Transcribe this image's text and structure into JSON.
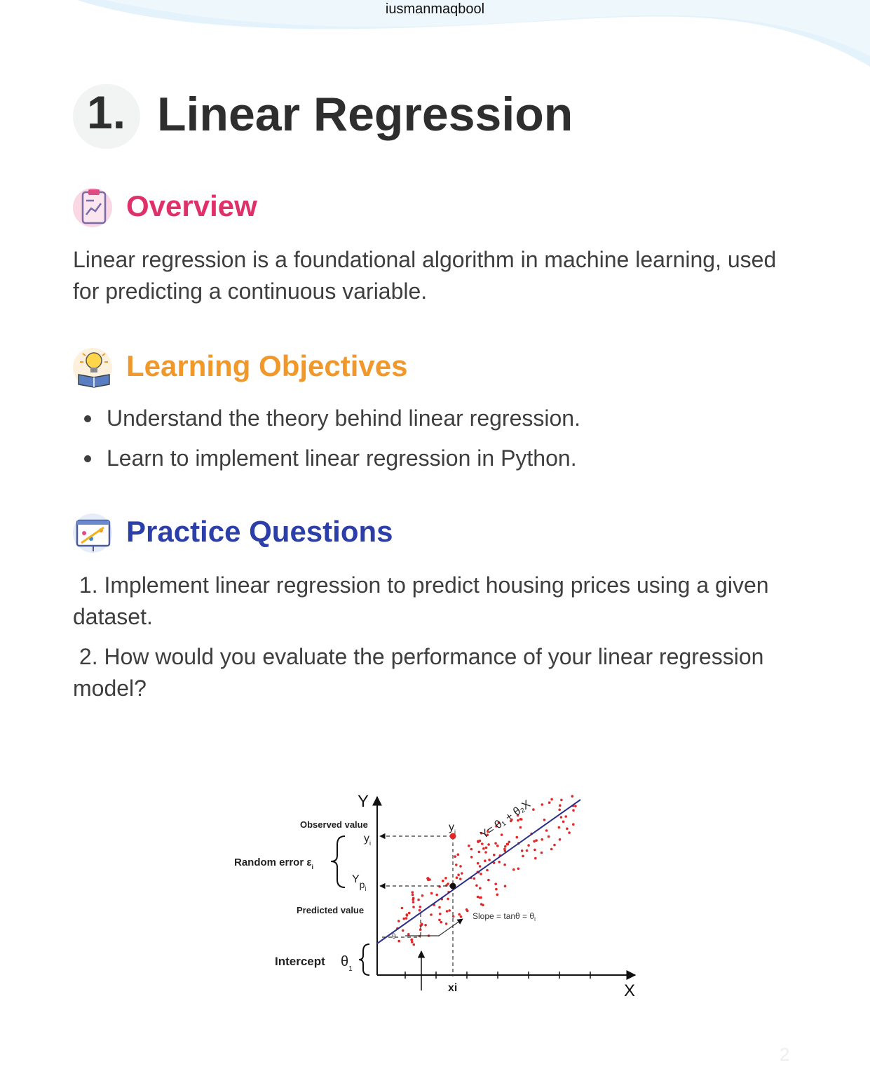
{
  "header": {
    "author": "iusmanmaqbool"
  },
  "title": {
    "number": "1.",
    "text": "Linear Regression"
  },
  "overview": {
    "heading": "Overview",
    "heading_color": "#e0306a",
    "icon": "clipboard-chart-icon",
    "text": "Linear regression is a foundational algorithm in machine learning, used for predicting a continuous variable."
  },
  "objectives": {
    "heading": "Learning Objectives",
    "heading_color": "#f0982a",
    "icon": "lightbulb-book-icon",
    "items": [
      "Understand the theory behind linear regression.",
      "Learn to implement linear regression in Python."
    ]
  },
  "practice": {
    "heading": "Practice Questions",
    "heading_color": "#2c3ea8",
    "icon": "presentation-board-icon",
    "q1": " 1. Implement linear regression to predict housing prices using a given dataset.",
    "q2": " 2. How would you evaluate the performance of your linear regression model?"
  },
  "diagram": {
    "y_axis": "Y",
    "x_axis": "X",
    "observed_label": "Observed value",
    "observed_symbol": "y",
    "observed_sub": "i",
    "random_error": "Random error ε",
    "random_error_sub": "i",
    "predicted_symbol": "Y",
    "predicted_sub": "p",
    "predicted_sub2": "i",
    "predicted_label": "Predicted value",
    "point_label": "y",
    "point_sub": "i",
    "equation": "Y= θ₁ + θ₂X",
    "slope": "Slope = tanθ = θ",
    "slope_sub": "i",
    "theta": "θ",
    "intercept": "Intercept",
    "intercept_symbol": "θ",
    "intercept_sub": "1",
    "xi": "xi",
    "point_color": "#e02828",
    "line_color": "#2a2f8a"
  },
  "page_number": "2"
}
